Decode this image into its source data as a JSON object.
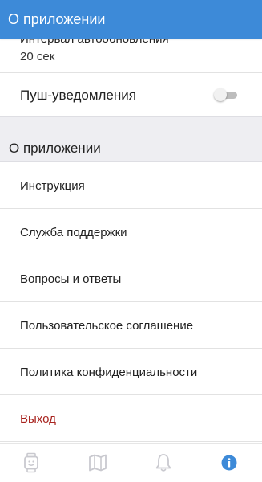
{
  "header": {
    "title": "О приложении"
  },
  "settings": {
    "interval_label": "Интервал автообновления",
    "interval_value": "20 сек",
    "push_label": "Пуш-уведомления",
    "push_enabled": false
  },
  "about_section": {
    "title": "О приложении",
    "items": [
      {
        "label": "Инструкция"
      },
      {
        "label": "Служба поддержки"
      },
      {
        "label": "Вопросы и ответы"
      },
      {
        "label": "Пользовательское соглашение"
      },
      {
        "label": "Политика конфиденциальности"
      },
      {
        "label": "Выход"
      }
    ]
  },
  "tabbar": {
    "tabs": [
      {
        "icon": "watch-icon",
        "active": false
      },
      {
        "icon": "map-icon",
        "active": false
      },
      {
        "icon": "bell-icon",
        "active": false
      },
      {
        "icon": "info-icon",
        "active": true
      }
    ]
  },
  "colors": {
    "accent": "#3d8ad8",
    "logout": "#a8231e",
    "section_bg": "#eeeef2",
    "inactive_icon": "#c9c9cf"
  }
}
